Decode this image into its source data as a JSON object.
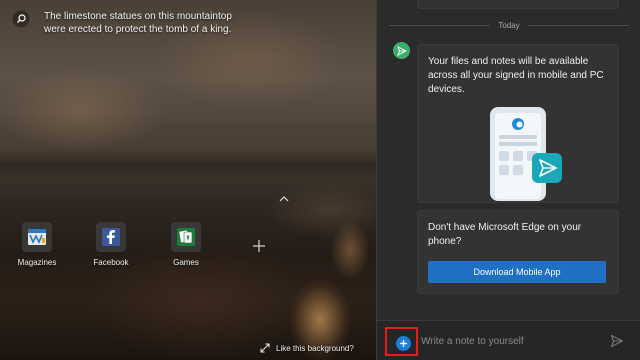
{
  "background": {
    "caption": "The limestone statues on this mountaintop were erected to protect the tomb of a king.",
    "like_label": "Like this background?"
  },
  "quick_links": [
    {
      "label": "Magazines",
      "icon": "magazines-icon"
    },
    {
      "label": "Facebook",
      "icon": "facebook-icon"
    },
    {
      "label": "Games",
      "icon": "games-icon"
    }
  ],
  "chat": {
    "date_label": "Today",
    "message1": "Your files and notes will be available across all your signed in mobile and PC devices.",
    "message2": "Don't have Microsoft Edge on your phone?",
    "download_label": "Download Mobile App",
    "input_placeholder": "Write a note to yourself"
  },
  "colors": {
    "accent": "#1f6fc4",
    "avatar": "#3bb06a",
    "highlight": "#e01e1e",
    "panel": "#2b2b2b"
  }
}
